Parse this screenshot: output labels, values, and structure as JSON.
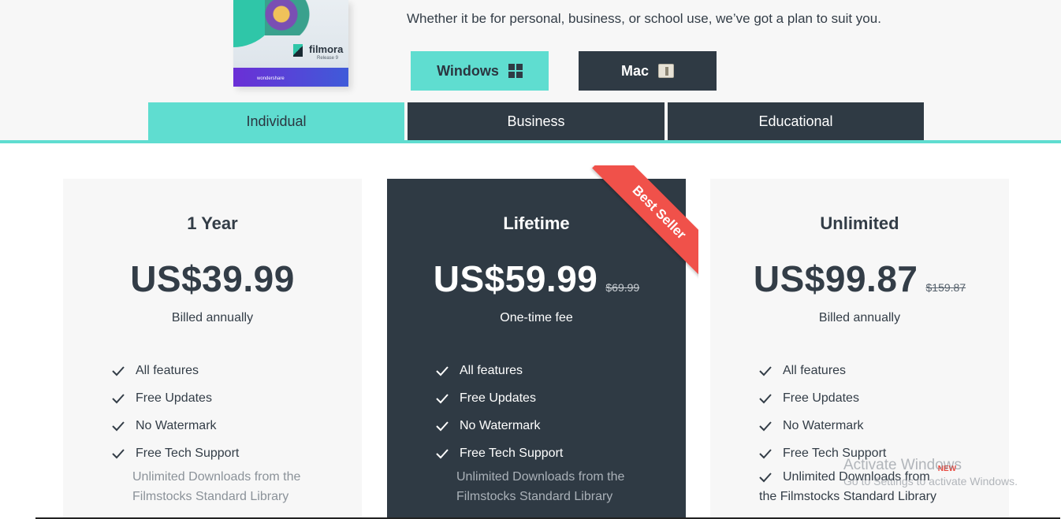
{
  "header": {
    "product": {
      "brand": "filmora",
      "release": "Release 9",
      "maker": "wondershare"
    },
    "tagline": "Whether it be for personal, business, or school use, we’ve got a plan to suit you.",
    "os_buttons": {
      "windows": "Windows",
      "mac": "Mac"
    }
  },
  "tabs": [
    {
      "label": "Individual",
      "active": true
    },
    {
      "label": "Business",
      "active": false
    },
    {
      "label": "Educational",
      "active": false
    }
  ],
  "plans": [
    {
      "name": "1 Year",
      "price": "US$39.99",
      "old_price": "",
      "billing": "Billed annually",
      "features": [
        "All features",
        "Free Updates",
        "No Watermark",
        "Free Tech Support"
      ],
      "extra": "Unlimited Downloads from the Filmstocks Standard Library"
    },
    {
      "name": "Lifetime",
      "price": "US$59.99",
      "old_price": "$69.99",
      "billing": "One-time fee",
      "badge": "Best Seller",
      "features": [
        "All features",
        "Free Updates",
        "No Watermark",
        "Free Tech Support"
      ],
      "extra": "Unlimited Downloads from the Filmstocks Standard Library"
    },
    {
      "name": "Unlimited",
      "price": "US$99.87",
      "old_price": "$159.87",
      "billing": "Billed annually",
      "features": [
        "All features",
        "Free Updates",
        "No Watermark",
        "Free Tech Support"
      ],
      "extra_line1": "Unlimited Downloads from",
      "extra_line2": "the Filmstocks Standard Library",
      "extra_badge": "NEW"
    }
  ],
  "watermark": {
    "title": "Activate Windows",
    "subtitle": "Go to Settings to activate Windows."
  },
  "colors": {
    "accent": "#5fddd0",
    "dark": "#2f3a44",
    "ribbon": "#f0514a"
  }
}
